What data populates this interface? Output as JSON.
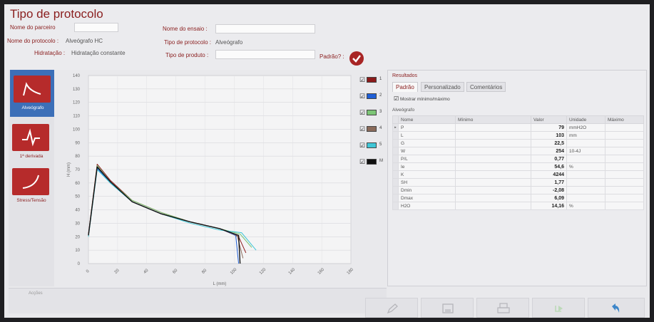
{
  "header": {
    "title": "Tipo de protocolo",
    "partner_label": "Nome do parceiro",
    "partner_value": "",
    "test_name_label": "Nome do ensaio :",
    "test_name_value": "",
    "protocol_name_label": "Nome do protocolo :",
    "protocol_name_value": "Alveógrafo HC",
    "protocol_type_label": "Tipo de protocolo :",
    "protocol_type_value": "Alveógrafo",
    "hydration_label": "Hidratação :",
    "hydration_value": "Hidratação constante",
    "product_type_label": "Tipo de produto :",
    "product_type_value": "",
    "default_label": "Padrão? :"
  },
  "nav": {
    "items": [
      {
        "label": "Alveógrafo",
        "icon": "alveograph-curve-icon",
        "selected": true
      },
      {
        "label": "1ª derivada",
        "icon": "derivative-icon",
        "selected": false
      },
      {
        "label": "Stress/Tensão",
        "icon": "stress-curve-icon",
        "selected": false
      }
    ]
  },
  "chart_data": {
    "type": "line",
    "xlabel": "L (mm)",
    "ylabel": "H (mm)",
    "xlim": [
      0,
      180
    ],
    "ylim": [
      0,
      140
    ],
    "x_ticks": [
      "0",
      "20",
      "40",
      "60",
      "80",
      "100",
      "120",
      "140",
      "160",
      "180"
    ],
    "y_ticks": [
      "0",
      "10",
      "20",
      "30",
      "40",
      "50",
      "60",
      "70",
      "80",
      "90",
      "100",
      "110",
      "120",
      "130",
      "140"
    ],
    "grid": true,
    "series": [
      {
        "name": "1",
        "color": "#8b1a1a",
        "points": [
          [
            0,
            22
          ],
          [
            6,
            74
          ],
          [
            15,
            62
          ],
          [
            30,
            47
          ],
          [
            50,
            38
          ],
          [
            70,
            31
          ],
          [
            90,
            26
          ],
          [
            103,
            20
          ],
          [
            108,
            8
          ]
        ]
      },
      {
        "name": "2",
        "color": "#1f5fd6",
        "points": [
          [
            0,
            21
          ],
          [
            6,
            71
          ],
          [
            15,
            60
          ],
          [
            30,
            46
          ],
          [
            50,
            37
          ],
          [
            70,
            31
          ],
          [
            90,
            26
          ],
          [
            101,
            21
          ],
          [
            103,
            0
          ]
        ]
      },
      {
        "name": "3",
        "color": "#7cc576",
        "points": [
          [
            0,
            21
          ],
          [
            6,
            73
          ],
          [
            15,
            61
          ],
          [
            30,
            47
          ],
          [
            50,
            38
          ],
          [
            70,
            31
          ],
          [
            90,
            26
          ],
          [
            104,
            22
          ],
          [
            112,
            12
          ]
        ]
      },
      {
        "name": "4",
        "color": "#8a6a5a",
        "points": [
          [
            0,
            21
          ],
          [
            6,
            72
          ],
          [
            15,
            61
          ],
          [
            30,
            46
          ],
          [
            50,
            37
          ],
          [
            70,
            31
          ],
          [
            90,
            26
          ],
          [
            102,
            21
          ],
          [
            106,
            4
          ]
        ]
      },
      {
        "name": "5",
        "color": "#3fc6d6",
        "points": [
          [
            0,
            20
          ],
          [
            6,
            70
          ],
          [
            15,
            60
          ],
          [
            30,
            46
          ],
          [
            50,
            37
          ],
          [
            70,
            30
          ],
          [
            90,
            25
          ],
          [
            105,
            23
          ],
          [
            115,
            10
          ]
        ]
      },
      {
        "name": "M",
        "color": "#111111",
        "points": [
          [
            0,
            21
          ],
          [
            6,
            72
          ],
          [
            15,
            61
          ],
          [
            30,
            46
          ],
          [
            50,
            37
          ],
          [
            70,
            31
          ],
          [
            90,
            26
          ],
          [
            103,
            21
          ],
          [
            104,
            0
          ]
        ]
      }
    ]
  },
  "legend": {
    "items": [
      {
        "name": "1",
        "color": "#8b1a1a",
        "checked": true
      },
      {
        "name": "2",
        "color": "#1f5fd6",
        "checked": true
      },
      {
        "name": "3",
        "color": "#7cc576",
        "checked": true
      },
      {
        "name": "4",
        "color": "#8a6a5a",
        "checked": true
      },
      {
        "name": "5",
        "color": "#3fc6d6",
        "checked": true
      },
      {
        "name": "M",
        "color": "#111111",
        "checked": true
      }
    ]
  },
  "results": {
    "title": "Resultados",
    "tabs": [
      "Padrão",
      "Personalizado",
      "Comentários"
    ],
    "show_minmax_label": "Mostrar mínimo/máximo",
    "section": "Alveógrafo",
    "columns": [
      "Nome",
      "Mínimo",
      "Valor",
      "Unidade",
      "Máximo"
    ],
    "rows": [
      {
        "name": "P",
        "min": "",
        "value": "79",
        "unit": "mmH2O",
        "max": ""
      },
      {
        "name": "L",
        "min": "",
        "value": "103",
        "unit": "mm",
        "max": ""
      },
      {
        "name": "G",
        "min": "",
        "value": "22,5",
        "unit": "",
        "max": ""
      },
      {
        "name": "W",
        "min": "",
        "value": "254",
        "unit": "10-4J",
        "max": ""
      },
      {
        "name": "P/L",
        "min": "",
        "value": "0,77",
        "unit": "",
        "max": ""
      },
      {
        "name": "Ie",
        "min": "",
        "value": "54,6",
        "unit": "%",
        "max": ""
      },
      {
        "name": "K",
        "min": "",
        "value": "4244",
        "unit": "",
        "max": ""
      },
      {
        "name": "SH",
        "min": "",
        "value": "1,77",
        "unit": "",
        "max": ""
      },
      {
        "name": "Dmin",
        "min": "",
        "value": "-2,08",
        "unit": "",
        "max": ""
      },
      {
        "name": "Dmax",
        "min": "",
        "value": "6,09",
        "unit": "",
        "max": ""
      },
      {
        "name": "H2O",
        "min": "",
        "value": "14,16",
        "unit": "%",
        "max": ""
      }
    ]
  },
  "actions": {
    "label": "Acções"
  },
  "toolbar": [
    {
      "name": "edit-button",
      "icon": "pencil-icon"
    },
    {
      "name": "save-button",
      "icon": "floppy-disk-icon"
    },
    {
      "name": "print-button",
      "icon": "printer-icon"
    },
    {
      "name": "export-button",
      "icon": "export-icon"
    },
    {
      "name": "back-button",
      "icon": "undo-arrow-icon"
    }
  ],
  "colors": {
    "accent": "#a82525",
    "selected_nav": "#3c6fb8",
    "label_text": "#8a1e1e"
  }
}
